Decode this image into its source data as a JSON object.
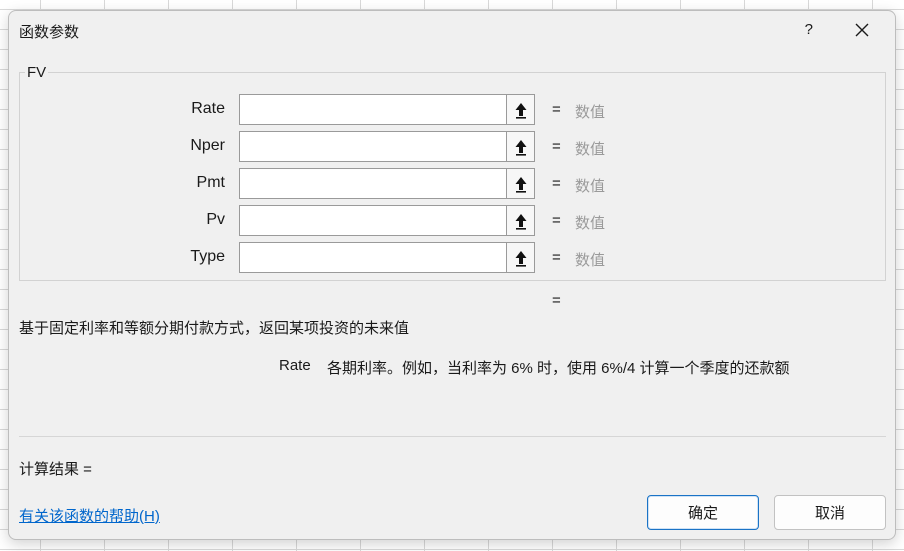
{
  "dialog": {
    "title": "函数参数",
    "help_glyph": "?",
    "function_name": "FV",
    "arguments": [
      {
        "label": "Rate",
        "value": "",
        "hint": "数值"
      },
      {
        "label": "Nper",
        "value": "",
        "hint": "数值"
      },
      {
        "label": "Pmt",
        "value": "",
        "hint": "数值"
      },
      {
        "label": "Pv",
        "value": "",
        "hint": "数值"
      },
      {
        "label": "Type",
        "value": "",
        "hint": "数值"
      }
    ],
    "equals": "=",
    "description": "基于固定利率和等额分期付款方式，返回某项投资的未来值",
    "arg_help_name": "Rate",
    "arg_help_text": "各期利率。例如，当利率为 6% 时，使用 6%/4 计算一个季度的还款额",
    "calc_result_label": "计算结果 =",
    "help_link": "有关该函数的帮助(H)",
    "ok_label": "确定",
    "cancel_label": "取消"
  },
  "colors": {
    "link": "#0066cc",
    "hint_gray": "#9a9a9a",
    "ok_border": "#1a73c6",
    "dialog_bg": "#f0f0f0"
  }
}
